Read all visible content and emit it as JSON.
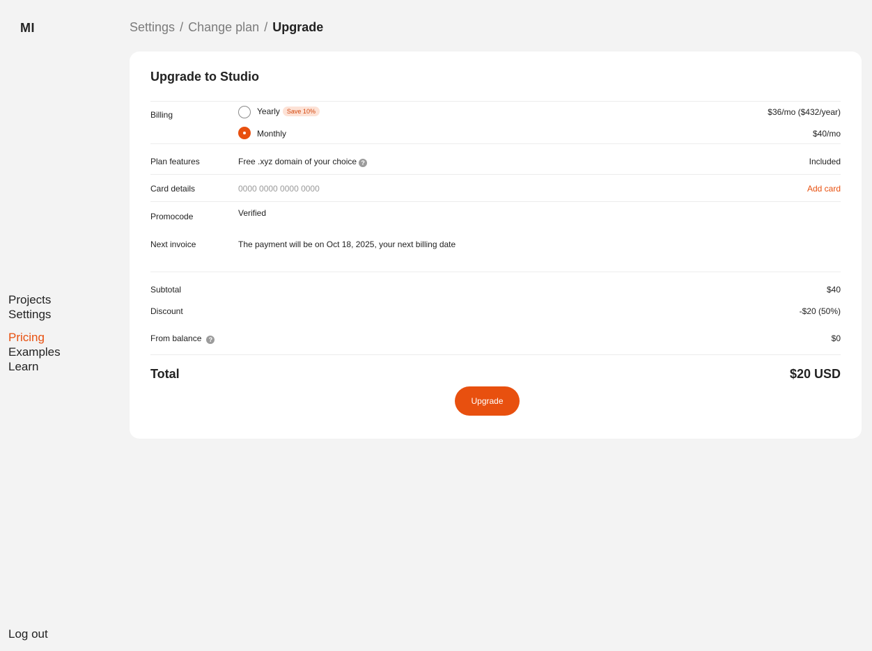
{
  "logo": "MI",
  "breadcrumb": {
    "items": [
      "Settings",
      "Change plan"
    ],
    "separator": "/",
    "current": "Upgrade"
  },
  "sidebar": {
    "items": [
      {
        "label": "Projects",
        "active": false
      },
      {
        "label": "Settings",
        "active": false
      },
      {
        "label": "Pricing",
        "active": true
      },
      {
        "label": "Examples",
        "active": false
      },
      {
        "label": "Learn",
        "active": false
      }
    ],
    "logout": "Log out"
  },
  "card": {
    "title": "Upgrade to Studio",
    "billing": {
      "label": "Billing",
      "options": [
        {
          "label": "Yearly",
          "badge": "Save 10%",
          "price": "$36/mo ($432/year)",
          "selected": false
        },
        {
          "label": "Monthly",
          "price": "$40/mo",
          "selected": true
        }
      ]
    },
    "plan_features": {
      "label": "Plan features",
      "value": "Free .xyz domain of your choice",
      "status": "Included",
      "help_icon": "help-icon"
    },
    "card_details": {
      "label": "Card details",
      "placeholder": "0000 0000 0000 0000",
      "action": "Add card"
    },
    "promocode": {
      "label": "Promocode",
      "value": "Verified"
    },
    "next_invoice": {
      "label": "Next invoice",
      "value": "The payment will be on Oct 18, 2025, your next billing date"
    },
    "subtotal": {
      "label": "Subtotal",
      "value": "$40"
    },
    "discount": {
      "label": "Discount",
      "value": "-$20 (50%)"
    },
    "from_balance": {
      "label": "From balance",
      "value": "$0",
      "help_icon": "help-icon"
    },
    "total": {
      "label": "Total",
      "value": "$20 USD"
    },
    "upgrade_button": "Upgrade"
  },
  "colors": {
    "accent": "#e8500f",
    "background": "#f3f3f3",
    "card": "#ffffff",
    "badge_bg": "#fde2d6"
  }
}
